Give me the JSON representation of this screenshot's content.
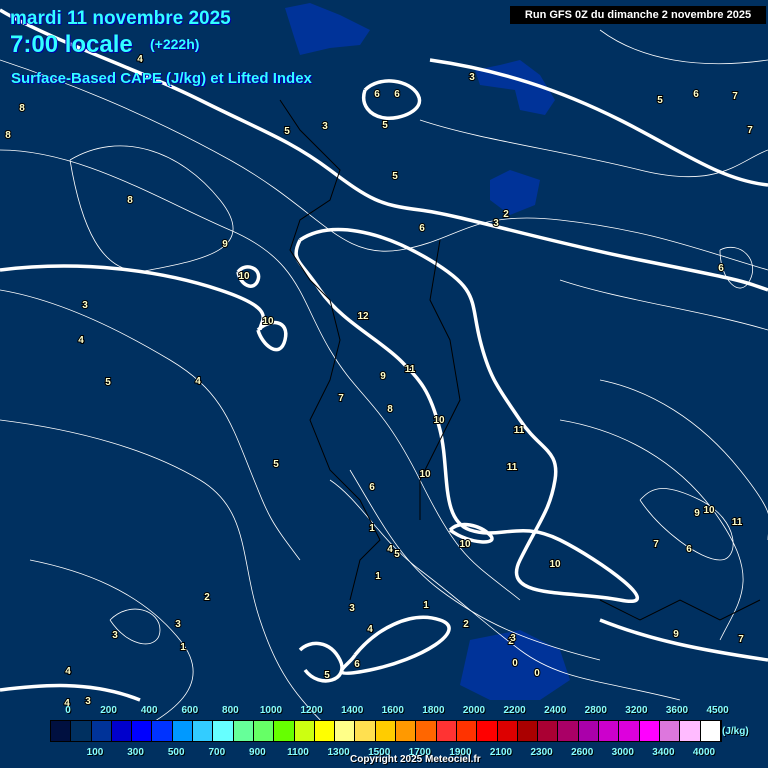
{
  "header": {
    "date": "mardi 11 novembre 2025",
    "time": "7:00 locale",
    "lead": "(+222h)",
    "parameter": "Surface-Based CAPE (J/kg) et Lifted Index",
    "run": "Run GFS 0Z du dimanche 2 novembre 2025"
  },
  "legend": {
    "colors": [
      "#001040",
      "#003060",
      "#003399",
      "#0000cc",
      "#0000ff",
      "#0033ff",
      "#0099ff",
      "#33ccff",
      "#66ffff",
      "#66ff99",
      "#66ff66",
      "#66ff00",
      "#ccff11",
      "#ffff00",
      "#ffff88",
      "#ffe050",
      "#ffcc00",
      "#ff9900",
      "#ff6600",
      "#ff3333",
      "#ff3300",
      "#ff0000",
      "#dd0000",
      "#aa0000",
      "#aa0033",
      "#aa0066",
      "#aa00aa",
      "#cc00cc",
      "#dd00dd",
      "#ff00ff",
      "#dd77dd",
      "#ffbbff",
      "#ffffff"
    ],
    "top_labels": [
      "0",
      "200",
      "400",
      "600",
      "800",
      "1000",
      "1200",
      "1400",
      "1600",
      "1800",
      "2000",
      "2200",
      "2400",
      "2800",
      "3200",
      "3600",
      "4500"
    ],
    "bottom_labels": [
      "100",
      "300",
      "500",
      "700",
      "900",
      "1100",
      "1300",
      "1500",
      "1700",
      "1900",
      "2100",
      "2300",
      "2600",
      "3000",
      "3400",
      "4000"
    ],
    "unit": "(J/kg)"
  },
  "contour_labels": [
    "4",
    "3",
    "6",
    "6",
    "5",
    "5",
    "3",
    "5",
    "3",
    "2",
    "6",
    "5",
    "6",
    "7",
    "7",
    "8",
    "8",
    "8",
    "9",
    "10",
    "10",
    "3",
    "4",
    "5",
    "4",
    "12",
    "11",
    "9",
    "7",
    "8",
    "10",
    "11",
    "11",
    "10",
    "5",
    "6",
    "1",
    "4",
    "5",
    "1",
    "1",
    "10",
    "10",
    "3",
    "7",
    "9",
    "10",
    "11",
    "6",
    "2",
    "2",
    "3",
    "4",
    "4",
    "4",
    "3",
    "1",
    "0",
    "0",
    "2",
    "5",
    "6",
    "9",
    "7",
    "6",
    "3",
    "3"
  ],
  "copyright": "Copyright 2025 Meteociel.fr",
  "colors": {
    "background": "#003060",
    "cape_low": "#003399",
    "title": "#33ffff"
  }
}
